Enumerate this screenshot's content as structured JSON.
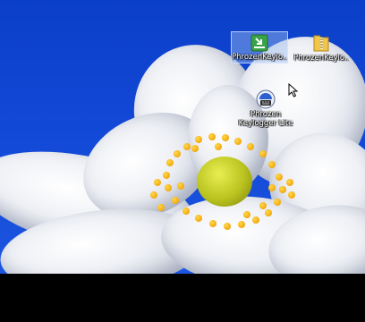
{
  "desktop": {
    "icons": [
      {
        "label": "PhrozenKeylo...",
        "icon": "green-download-arrow-icon",
        "selected": true
      },
      {
        "label": "PhrozenKeylo...",
        "icon": "zip-folder-icon",
        "selected": false
      },
      {
        "label_line1": "Phrozen",
        "label_line2": "Keylogger Lite",
        "icon": "phrozen-keylogger-app-icon",
        "selected": false
      }
    ],
    "wallpaper": "white anemone flower on blue sky",
    "colors": {
      "sky": "#1248d6",
      "selection": "#a0bef0",
      "petal": "#f0f2f7",
      "stamen": "#f2a90f",
      "center": "#b9c21f"
    }
  },
  "cursor": "arrow-pointer-icon"
}
